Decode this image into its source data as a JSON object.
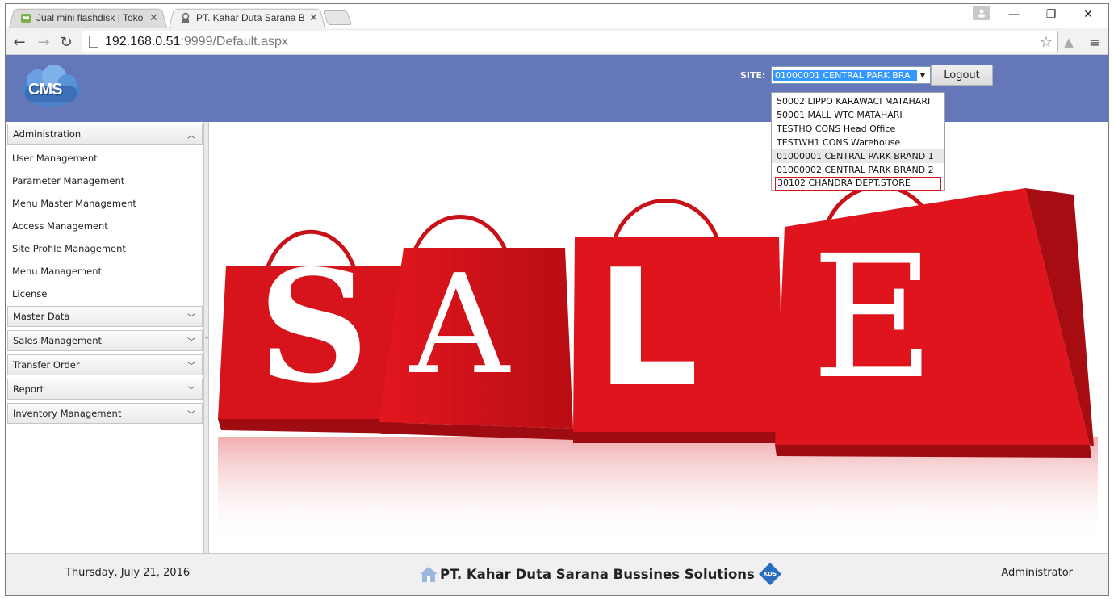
{
  "browser": {
    "tabs": [
      {
        "title": "Jual mini flashdisk | Tokop",
        "active": false
      },
      {
        "title": "PT. Kahar Duta Sarana Bus",
        "active": true
      }
    ],
    "url_host": "192.168.0.51",
    "url_rest": ":9999/Default.aspx"
  },
  "header": {
    "logo_text": "CMS",
    "site_label": "SITE:",
    "site_selected": "01000001 CENTRAL PARK BRA",
    "logout_label": "Logout",
    "site_options": [
      "50002 LIPPO KARAWACI MATAHARI",
      "50001 MALL WTC MATAHARI",
      "TESTHO CONS Head Office",
      "TESTWH1 CONS Warehouse",
      "01000001 CENTRAL PARK BRAND 1",
      "01000002 CENTRAL PARK BRAND 2",
      "30102 CHANDRA DEPT.STORE"
    ]
  },
  "sidebar": {
    "administration": {
      "title": "Administration",
      "items": [
        "User Management",
        "Parameter Management",
        "Menu Master Management",
        "Access Management",
        "Site Profile Management",
        "Menu Management",
        "License"
      ]
    },
    "sections": [
      "Master Data",
      "Sales Management",
      "Transfer Order",
      "Report",
      "Inventory Management"
    ]
  },
  "banner": {
    "letters": [
      "S",
      "A",
      "L",
      "E"
    ]
  },
  "footer": {
    "date": "Thursday, July 21, 2016",
    "company": "PT. Kahar Duta Sarana Bussines Solutions",
    "user": "Administrator",
    "kds_logo_text": "KDS"
  },
  "colors": {
    "header_bg": "#6477b8",
    "bag_red": "#d7141c",
    "highlight_outline": "#d0141e"
  }
}
